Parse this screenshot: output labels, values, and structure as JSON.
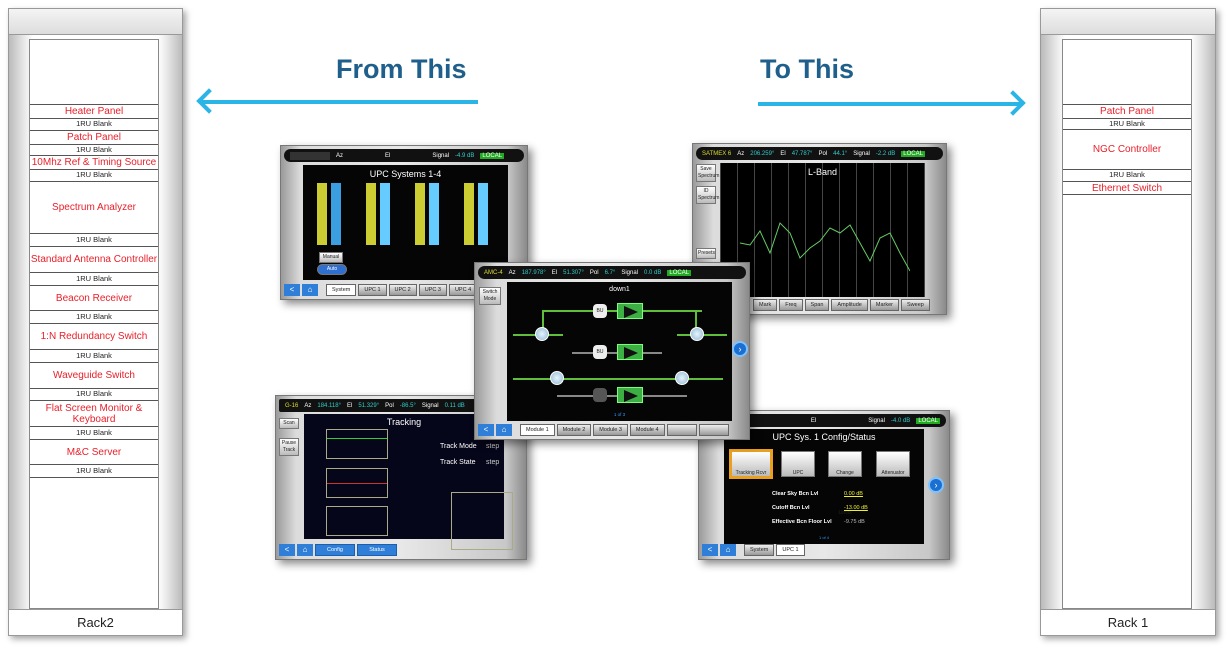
{
  "headings": {
    "from": "From This",
    "to": "To This"
  },
  "colors": {
    "heading": "#1f5f8b",
    "arrow": "#2bb5e6",
    "device_label": "#e8202a"
  },
  "rack2": {
    "label": "Rack2",
    "rows": [
      {
        "label": "Heater Panel",
        "type": "device"
      },
      {
        "label": "1RU Blank",
        "type": "blank"
      },
      {
        "label": "Patch Panel",
        "type": "device"
      },
      {
        "label": "1RU Blank",
        "type": "blank"
      },
      {
        "label": "10Mhz Ref & Timing Source",
        "type": "device"
      },
      {
        "label": "1RU Blank",
        "type": "blank"
      },
      {
        "label": "Spectrum Analyzer",
        "type": "device"
      },
      {
        "label": "1RU Blank",
        "type": "blank"
      },
      {
        "label": "Standard Antenna Controller",
        "type": "device"
      },
      {
        "label": "1RU Blank",
        "type": "blank"
      },
      {
        "label": "Beacon Receiver",
        "type": "device"
      },
      {
        "label": "1RU Blank",
        "type": "blank"
      },
      {
        "label": "1:N Redundancy Switch",
        "type": "device"
      },
      {
        "label": "1RU Blank",
        "type": "blank"
      },
      {
        "label": "Waveguide Switch",
        "type": "device"
      },
      {
        "label": "1RU Blank",
        "type": "blank"
      },
      {
        "label": "Flat Screen Monitor & Keyboard",
        "type": "device"
      },
      {
        "label": "1RU Blank",
        "type": "blank"
      },
      {
        "label": "M&C Server",
        "type": "device"
      },
      {
        "label": "1RU Blank",
        "type": "blank"
      }
    ]
  },
  "rack1": {
    "label": "Rack 1",
    "rows": [
      {
        "label": "Patch Panel",
        "type": "device"
      },
      {
        "label": "1RU Blank",
        "type": "blank"
      },
      {
        "label": "NGC Controller",
        "type": "device"
      },
      {
        "label": "1RU Blank",
        "type": "blank"
      },
      {
        "label": "Ethernet Switch",
        "type": "device"
      }
    ]
  },
  "screens": {
    "upc": {
      "az_label": "Az",
      "el_label": "El",
      "signal_label": "Signal",
      "signal": "-4.9 dB",
      "local": "LOCAL",
      "title": "UPC Systems 1-4",
      "manual": "Manual",
      "auto": "Auto",
      "tabs": [
        "System",
        "UPC 1",
        "UPC 2",
        "UPC 3",
        "UPC 4"
      ]
    },
    "spectrum": {
      "sat": "SATMEX 6",
      "az_label": "Az",
      "az": "206.259°",
      "el_label": "El",
      "el": "47.787°",
      "pol_label": "Pol",
      "pol": "44.1°",
      "signal_label": "Signal",
      "signal": "-2.2 dB",
      "local": "LOCAL",
      "title": "L-Band",
      "side": [
        "Save Spectrum",
        "ID Spectrum",
        "Presets"
      ],
      "tabs": [
        "Mark",
        "Freq",
        "Span",
        "Amplitude",
        "Marker",
        "Sweep"
      ]
    },
    "switch": {
      "sat": "AMC-4",
      "az_label": "Az",
      "az": "187.978°",
      "el_label": "El",
      "el": "51.307°",
      "pol_label": "Pol",
      "pol": "6.7°",
      "signal_label": "Signal",
      "signal": "0.0 dB",
      "local": "LOCAL",
      "side": "Switch Mode",
      "title": "down1",
      "bu": "BU",
      "amps": [
        "A",
        "B",
        "SB"
      ],
      "page": "1 of 3",
      "tabs": [
        "Module 1",
        "Module 2",
        "Module 3",
        "Module 4"
      ]
    },
    "tracking": {
      "sat": "G-16",
      "az_label": "Az",
      "az": "184.118°",
      "el_label": "El",
      "el": "51.329°",
      "pol_label": "Pol",
      "pol": "-86.5°",
      "signal_label": "Signal",
      "signal": "0.11 dB",
      "title": "Tracking",
      "side": [
        "Scan",
        "Pause Track"
      ],
      "track_mode_label": "Track Mode",
      "track_mode": "step",
      "track_state_label": "Track State",
      "track_state": "step",
      "tabs": [
        "Config",
        "Status"
      ]
    },
    "upc_config": {
      "el_label": "El",
      "signal_label": "Signal",
      "signal": "-4.0 dB",
      "local": "LOCAL",
      "title": "UPC Sys. 1 Config/Status",
      "flow": [
        "Tracking Rcvr",
        "UPC",
        "Change Limits",
        "Attenuator"
      ],
      "fields": [
        {
          "label": "Clear Sky Bcn Lvl",
          "value": "0.00 dB"
        },
        {
          "label": "Cutoff Bcn Lvl",
          "value": "-13.00 dB"
        },
        {
          "label": "Effective Bcn Floor Lvl",
          "value": "-9.75 dB"
        }
      ],
      "page": "1 of 4",
      "tabs": [
        "System",
        "UPC 1"
      ]
    }
  }
}
